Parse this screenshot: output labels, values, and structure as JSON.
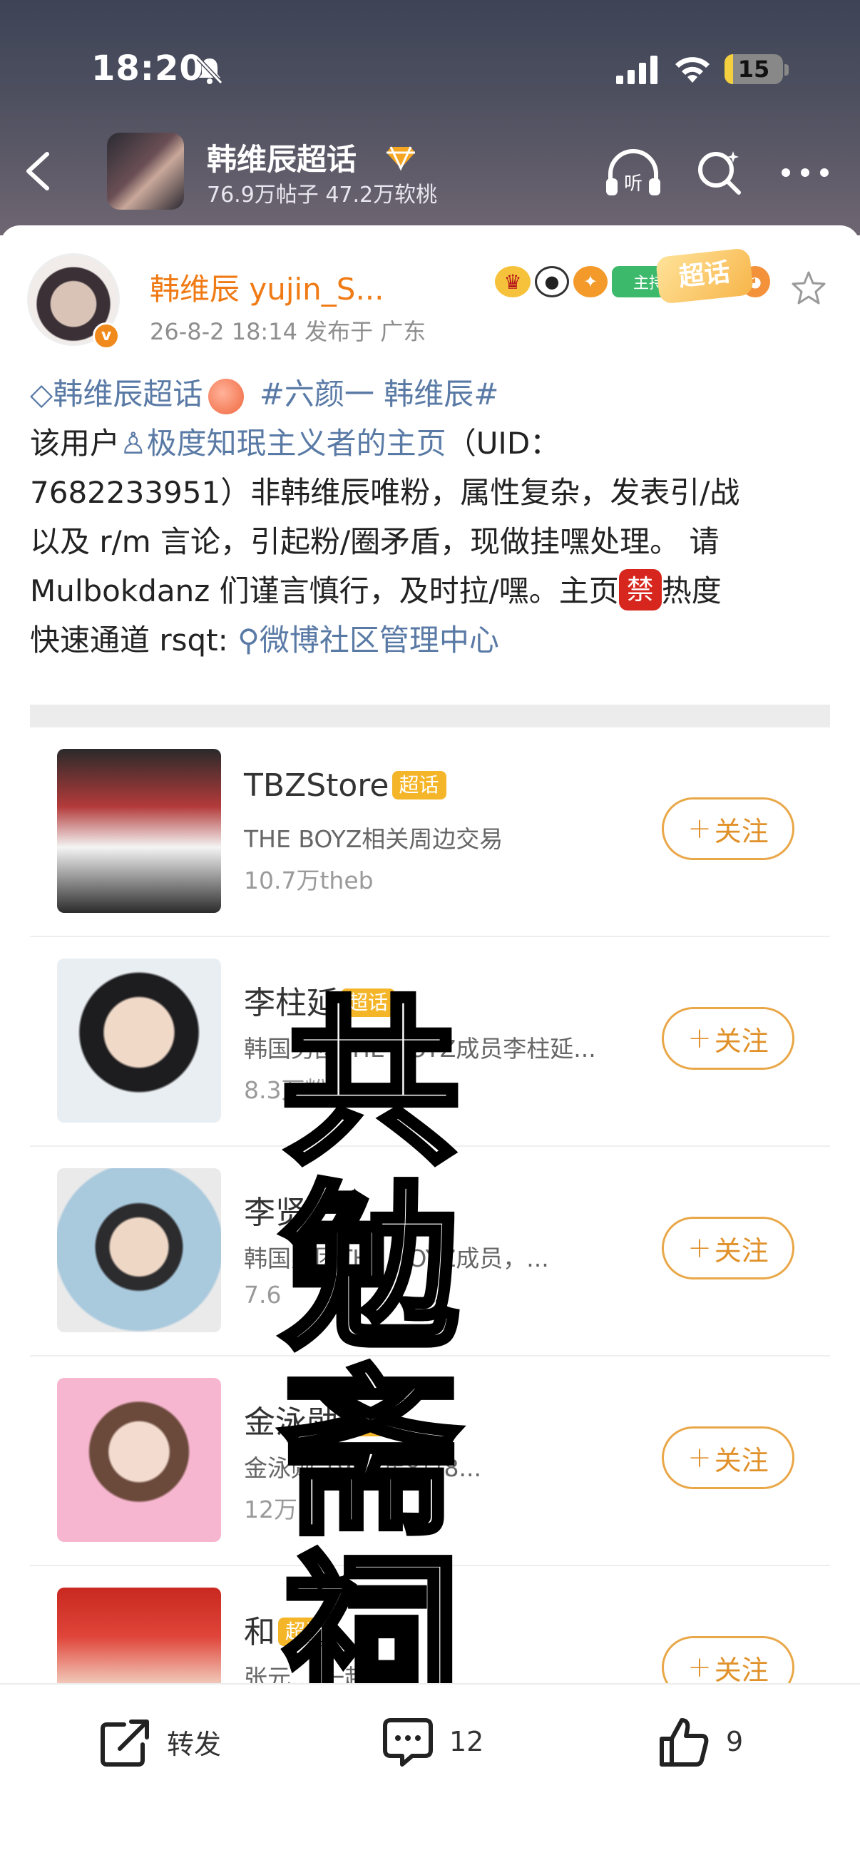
{
  "status_bar": {
    "time": "18:20",
    "battery": "15",
    "battery_level": 0.15
  },
  "nav": {
    "title": "韩维辰超话",
    "subtitle": "76.9万帖子 47.2万软桃"
  },
  "post": {
    "author_name": "韩维辰 yujin_S...",
    "host_badge": "主持人",
    "gem_badge_level": "15",
    "chaohua_badge": "超话",
    "avatar_badge": "v",
    "meta": "26-8-2 18:14  发布于 广东",
    "body": {
      "topic1": "韩维辰超话",
      "topic2": "#六颜一 韩维辰#",
      "line2_a": "该用户",
      "user_link": "极度知珉主义者的主页",
      "line2_b": "（UID：",
      "line3": "7682233951）非韩维辰唯粉，属性复杂，发表引/战",
      "line4": "以及 r/m 言论，引起粉/圈矛盾，现做挂嘿处理。 请",
      "line5_a": "Mulbokdanz 们谨言慎行，及时拉/嘿。主页",
      "ban_char": "禁",
      "line5_b": "热度",
      "line6_a": "快速通道 rsqt: ",
      "community_link": "微博社区管理中心"
    }
  },
  "list": {
    "follow_label": "关注",
    "super_tag": "超话",
    "rows": [
      {
        "title": "TBZStore",
        "desc": "THE BOYZ相关周边交易",
        "count": "10.7万theb"
      },
      {
        "title": "李柱延",
        "desc": "韩国男团THE BOYZ成员李柱延...",
        "count": "8.3万粉丝"
      },
      {
        "title": "李贤",
        "desc": "韩国男团THE BOYZ成员，...",
        "count": "7.6"
      },
      {
        "title": "金泳勋",
        "desc": "金泳勋 1997年8月8...",
        "count": "12万"
      },
      {
        "title": "和",
        "desc": "张元... 一起参加",
        "count": ""
      }
    ]
  },
  "overlay_chars": [
    "共",
    "勉",
    "斋",
    "祠"
  ],
  "bottom": {
    "repost": "转发",
    "comments": "12",
    "likes": "9"
  },
  "colors": {
    "accent": "#f07a14",
    "link": "#5a7aa6",
    "follow": "#e9a748",
    "super_tag": "#f5b528"
  }
}
